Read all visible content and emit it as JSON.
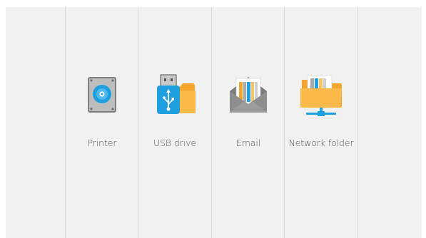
{
  "options": [
    {
      "label": "Printer",
      "icon": "printer-drive-icon"
    },
    {
      "label": "USB drive",
      "icon": "usb-drive-icon"
    },
    {
      "label": "Email",
      "icon": "email-icon"
    },
    {
      "label": "Network folder",
      "icon": "network-folder-icon"
    }
  ],
  "colors": {
    "panel": "#f1f1f1",
    "divider": "#d9d9d9",
    "accent_blue": "#1e9fe0",
    "folder_orange": "#f7a42a",
    "gray": "#8a8a8a"
  }
}
